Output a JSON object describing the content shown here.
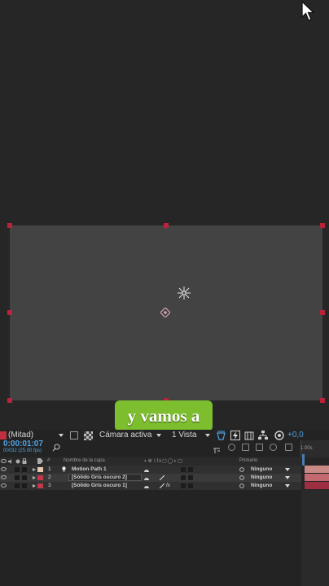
{
  "viewer": {
    "caption": "y vamos a"
  },
  "toolbar": {
    "resolution": "(Mitad)",
    "camera": "Cámara activa",
    "views": "1 Vista",
    "exposure": "+0,0"
  },
  "timeline": {
    "timecode": "0:00:01:07",
    "fps": "00032 (25.00 fps)",
    "ruler_mark": "1:00s",
    "columns": {
      "number": "#",
      "layer_name": "Nombre de la capa",
      "parent": "Primario"
    },
    "layers": [
      {
        "number": "1",
        "name": "Motion Path 1",
        "parent": "Ninguno",
        "label_color": "#e7c9b3",
        "bar_color": "#c98a86"
      },
      {
        "number": "2",
        "name": "[Sólido Gris oscuro 2]",
        "parent": "Ninguno",
        "label_color": "#c23848",
        "bar_color": "#c36a70"
      },
      {
        "number": "3",
        "name": "[Sólido Gris oscuro 1]",
        "parent": "Ninguno",
        "label_color": "#c23848",
        "bar_color": "#9e2f42"
      }
    ]
  },
  "colors": {
    "accent_blue": "#4fa3e0",
    "caption_green": "#7cbe2d",
    "handle_red": "#b8233c"
  }
}
